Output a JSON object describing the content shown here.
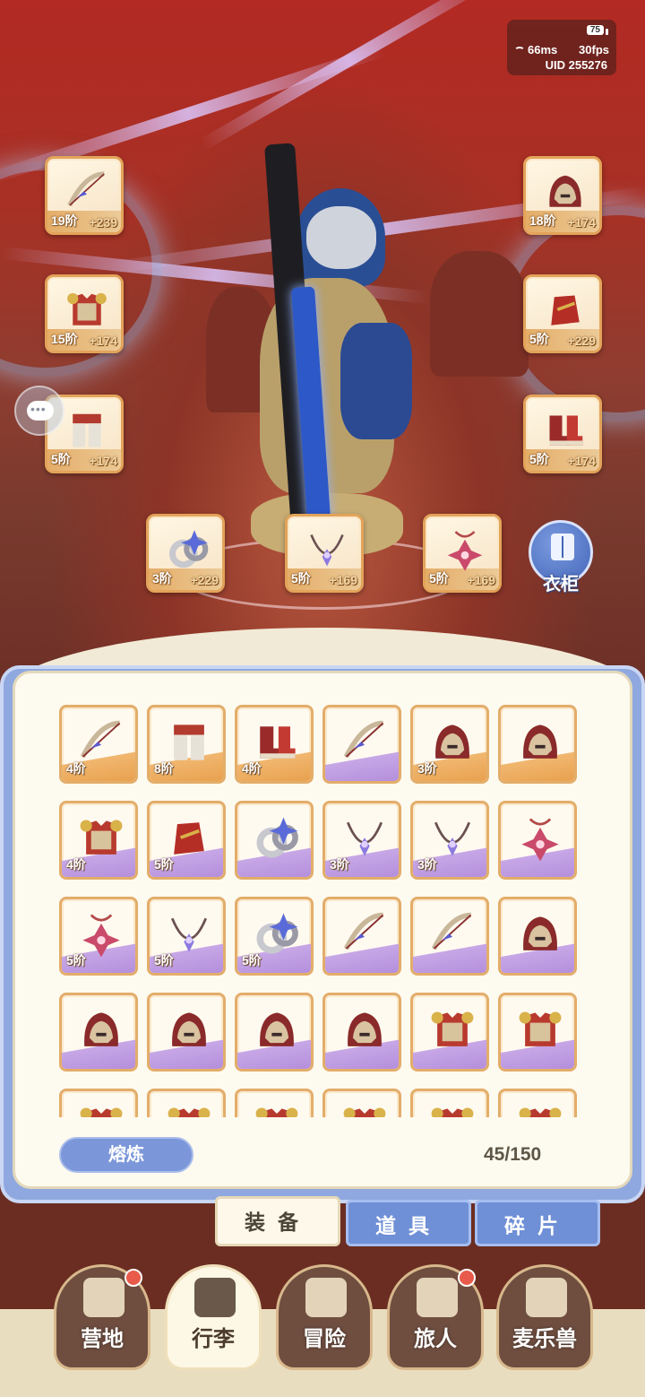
{
  "status": {
    "battery": "75",
    "ping": "66ms",
    "fps": "30fps",
    "uid": "UID 255276"
  },
  "equipped": {
    "left": [
      {
        "name": "bow",
        "level": "19阶",
        "plus": "+239"
      },
      {
        "name": "armor",
        "level": "15阶",
        "plus": "+174"
      },
      {
        "name": "leggings",
        "level": "5阶",
        "plus": "+174"
      }
    ],
    "right": [
      {
        "name": "helmet",
        "level": "18阶",
        "plus": "+174"
      },
      {
        "name": "gloves",
        "level": "5阶",
        "plus": "+229"
      },
      {
        "name": "boots",
        "level": "5阶",
        "plus": "+174"
      }
    ],
    "bottom": [
      {
        "name": "ring",
        "level": "3阶",
        "plus": "+229"
      },
      {
        "name": "necklace",
        "level": "5阶",
        "plus": "+169"
      },
      {
        "name": "amulet",
        "level": "5阶",
        "plus": "+169"
      }
    ]
  },
  "wardrobe_label": "衣柜",
  "inventory": {
    "rows": [
      [
        {
          "item": "bow",
          "level": "4阶",
          "rarity": "orange"
        },
        {
          "item": "leggings",
          "level": "8阶",
          "rarity": "orange"
        },
        {
          "item": "boots",
          "level": "4阶",
          "rarity": "orange"
        },
        {
          "item": "bow",
          "level": "",
          "rarity": "purple"
        },
        {
          "item": "helmet",
          "level": "3阶",
          "rarity": "orange"
        },
        {
          "item": "helmet",
          "level": "",
          "rarity": "orange"
        }
      ],
      [
        {
          "item": "armor",
          "level": "4阶",
          "rarity": "purple"
        },
        {
          "item": "gloves",
          "level": "5阶",
          "rarity": "purple"
        },
        {
          "item": "ring",
          "level": "",
          "rarity": "purple"
        },
        {
          "item": "necklace",
          "level": "3阶",
          "rarity": "purple"
        },
        {
          "item": "necklace",
          "level": "3阶",
          "rarity": "purple"
        },
        {
          "item": "amulet",
          "level": "",
          "rarity": "purple"
        }
      ],
      [
        {
          "item": "amulet",
          "level": "5阶",
          "rarity": "purple"
        },
        {
          "item": "necklace",
          "level": "5阶",
          "rarity": "purple"
        },
        {
          "item": "ring",
          "level": "5阶",
          "rarity": "purple"
        },
        {
          "item": "bow",
          "level": "",
          "rarity": "purple"
        },
        {
          "item": "bow",
          "level": "",
          "rarity": "purple"
        },
        {
          "item": "helmet",
          "level": "",
          "rarity": "purple"
        }
      ],
      [
        {
          "item": "helmet",
          "level": "",
          "rarity": "purple"
        },
        {
          "item": "helmet",
          "level": "",
          "rarity": "purple"
        },
        {
          "item": "helmet",
          "level": "",
          "rarity": "purple"
        },
        {
          "item": "helmet",
          "level": "",
          "rarity": "purple"
        },
        {
          "item": "armor",
          "level": "",
          "rarity": "purple"
        },
        {
          "item": "armor",
          "level": "",
          "rarity": "purple"
        }
      ],
      [
        {
          "item": "armor",
          "level": "",
          "rarity": "purple"
        },
        {
          "item": "armor",
          "level": "",
          "rarity": "purple"
        },
        {
          "item": "armor",
          "level": "",
          "rarity": "purple"
        },
        {
          "item": "armor",
          "level": "",
          "rarity": "purple"
        },
        {
          "item": "armor",
          "level": "",
          "rarity": "purple"
        },
        {
          "item": "armor",
          "level": "",
          "rarity": "purple"
        }
      ]
    ],
    "smelt_label": "熔炼",
    "capacity": "45/150"
  },
  "tabs": [
    {
      "label": "装备",
      "active": true
    },
    {
      "label": "道具",
      "active": false
    },
    {
      "label": "碎片",
      "active": false
    }
  ],
  "nav": [
    {
      "label": "营地",
      "icon": "castle-icon",
      "badge": true,
      "active": false
    },
    {
      "label": "行李",
      "icon": "backpack-icon",
      "badge": false,
      "active": true
    },
    {
      "label": "冒险",
      "icon": "crossed-swords-icon",
      "badge": false,
      "active": false
    },
    {
      "label": "旅人",
      "icon": "traveler-icon",
      "badge": true,
      "active": false
    },
    {
      "label": "麦乐兽",
      "icon": "fox-icon",
      "badge": false,
      "active": false
    }
  ],
  "colors": {
    "accent_blue": "#6f8fd6",
    "frame_orange": "#e3ad6a",
    "rarity_purple": "#b48fdc",
    "rarity_orange": "#e8a14e"
  }
}
